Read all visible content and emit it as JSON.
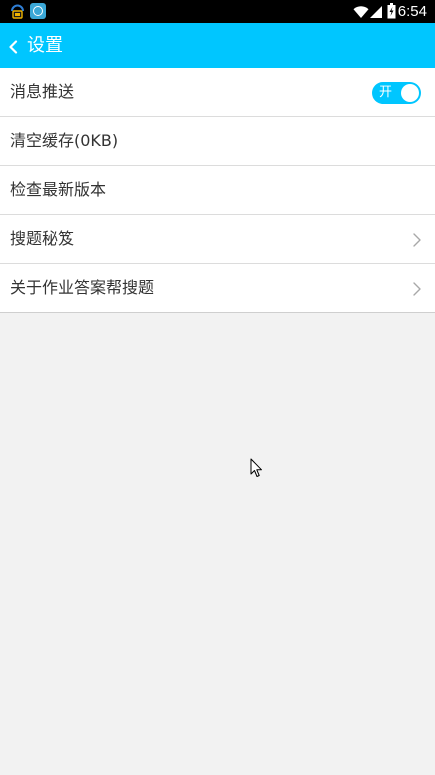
{
  "status_bar": {
    "time": "6:54",
    "notification_icons": [
      "tablet-app-icon",
      "chat-app-icon"
    ],
    "system_icons": [
      "wifi-icon",
      "signal-icon",
      "battery-icon"
    ]
  },
  "app_bar": {
    "back_icon": "chevron-left-icon",
    "title": "设置",
    "background": "#00c6ff"
  },
  "settings": {
    "items": [
      {
        "label": "消息推送",
        "control": "toggle"
      },
      {
        "label": "清空缓存(0KB)",
        "control": "none"
      },
      {
        "label": "检查最新版本",
        "control": "none"
      },
      {
        "label": "搜题秘笈",
        "control": "chevron-right-icon"
      },
      {
        "label": "关于作业答案帮搜题",
        "control": "chevron-right-icon"
      }
    ],
    "push_toggle": {
      "state_label": "开",
      "on": true,
      "color": "#00c6ff"
    }
  }
}
